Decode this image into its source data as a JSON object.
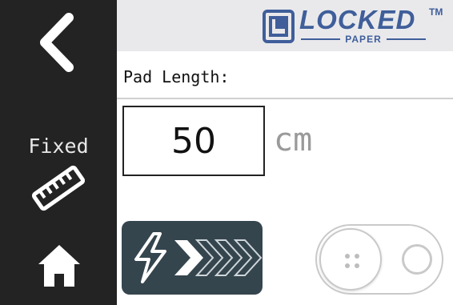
{
  "header": {
    "logo_text": "LOCKED",
    "logo_tm": "TM",
    "logo_subtext": "PAPER"
  },
  "sidebar": {
    "back_icon": "chevron-left-icon",
    "mode_label": "Fixed",
    "mode_icon": "ruler-icon",
    "home_icon": "home-icon"
  },
  "form": {
    "field_label": "Pad Length:",
    "length_value": "50",
    "unit": "cm"
  },
  "controls": {
    "speed_icon": "lightning-chevrons-icon",
    "toggle_state": "off"
  },
  "colors": {
    "sidebar_bg": "#232323",
    "header_bg": "#e9e9ec",
    "brand": "#3f5e9a",
    "speed_button_bg": "#35454e"
  }
}
